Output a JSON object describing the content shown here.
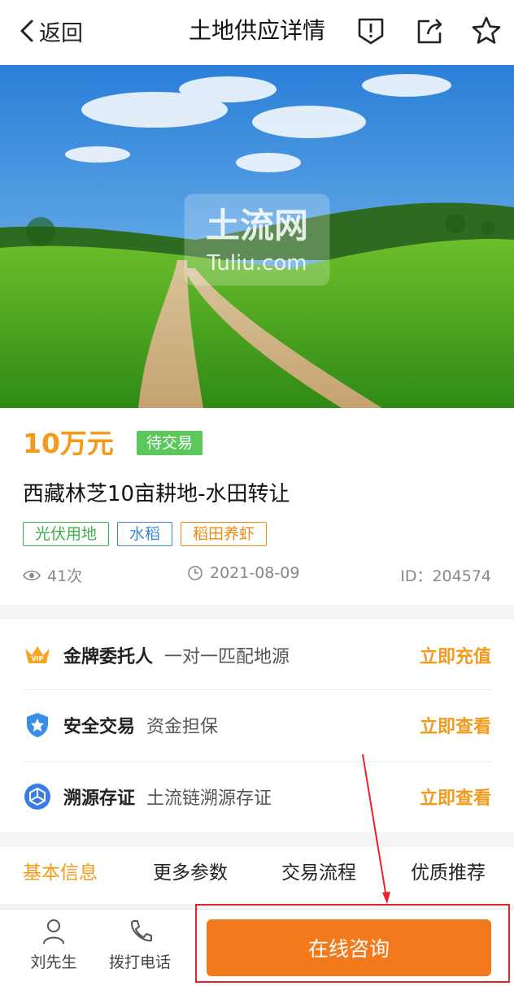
{
  "header": {
    "back_label": "返回",
    "title": "土地供应详情",
    "icons": [
      "report-icon",
      "share-icon",
      "star-icon"
    ]
  },
  "hero": {
    "watermark_main": "土流网",
    "watermark_sub": "Tuliu.com"
  },
  "listing": {
    "price": "10万元",
    "status": "待交易",
    "title": "西藏林芝10亩耕地-水田转让",
    "tags": [
      "光伏用地",
      "水稻",
      "稻田养虾"
    ],
    "views": "41次",
    "date": "2021-08-09",
    "id": "ID：204574"
  },
  "services": [
    {
      "icon": "vip-crown-icon",
      "name": "金牌委托人",
      "desc": "一对一匹配地源",
      "action": "立即充值"
    },
    {
      "icon": "shield-icon",
      "name": "安全交易",
      "desc": "资金担保",
      "action": "立即查看"
    },
    {
      "icon": "trace-chain-icon",
      "name": "溯源存证",
      "desc": "土流链溯源存证",
      "action": "立即查看"
    }
  ],
  "tabs": [
    "基本信息",
    "更多参数",
    "交易流程",
    "优质推荐"
  ],
  "bottom": {
    "contact_name": "刘先生",
    "call_label": "拨打电话",
    "consult_label": "在线咨询"
  },
  "colors": {
    "accent": "#f49a1a",
    "cta": "#f27a1d",
    "status_green": "#5cc85c",
    "annotation_red": "#e8222b"
  }
}
